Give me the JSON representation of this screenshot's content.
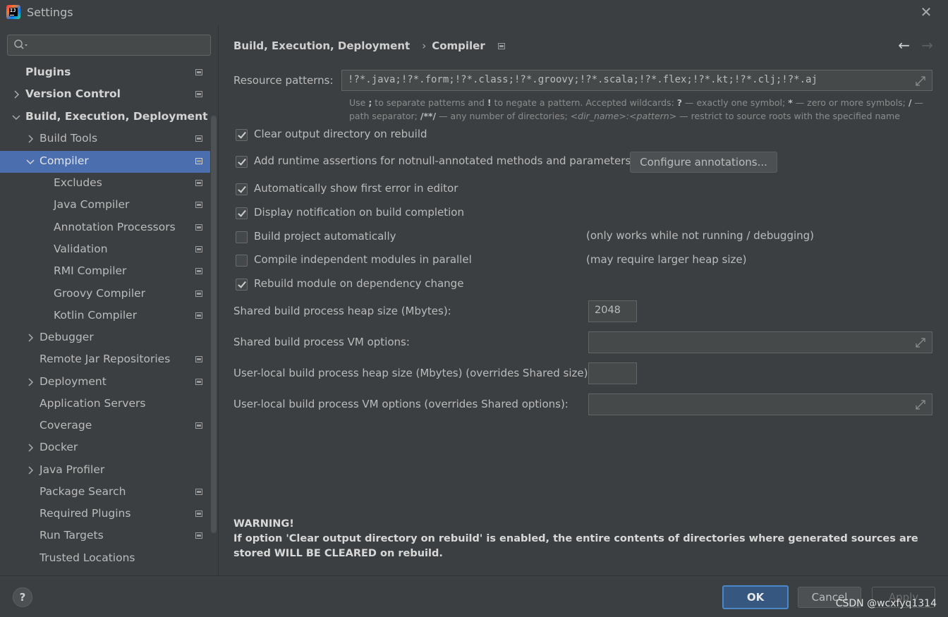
{
  "window": {
    "title": "Settings"
  },
  "search": {
    "placeholder": ""
  },
  "sidebar": {
    "items": [
      {
        "label": "Plugins"
      },
      {
        "label": "Version Control"
      },
      {
        "label": "Build, Execution, Deployment"
      },
      {
        "label": "Build Tools"
      },
      {
        "label": "Compiler"
      },
      {
        "label": "Excludes"
      },
      {
        "label": "Java Compiler"
      },
      {
        "label": "Annotation Processors"
      },
      {
        "label": "Validation"
      },
      {
        "label": "RMI Compiler"
      },
      {
        "label": "Groovy Compiler"
      },
      {
        "label": "Kotlin Compiler"
      },
      {
        "label": "Debugger"
      },
      {
        "label": "Remote Jar Repositories"
      },
      {
        "label": "Deployment"
      },
      {
        "label": "Application Servers"
      },
      {
        "label": "Coverage"
      },
      {
        "label": "Docker"
      },
      {
        "label": "Java Profiler"
      },
      {
        "label": "Package Search"
      },
      {
        "label": "Required Plugins"
      },
      {
        "label": "Run Targets"
      },
      {
        "label": "Trusted Locations"
      }
    ]
  },
  "breadcrumb": {
    "parent": "Build, Execution, Deployment",
    "current": "Compiler"
  },
  "resource_patterns": {
    "label": "Resource patterns:",
    "value": "!?*.java;!?*.form;!?*.class;!?*.groovy;!?*.scala;!?*.flex;!?*.kt;!?*.clj;!?*.aj"
  },
  "hint": {
    "l1a": "Use ",
    "l1b": ";",
    "l1c": " to separate patterns and ",
    "l1d": "!",
    "l1e": " to negate a pattern. Accepted wildcards: ",
    "l1f": "?",
    "l1g": " — exactly one symbol; ",
    "l1h": "*",
    "l1i": " — zero or more symbols; ",
    "l1j": "/",
    "l1k": " —",
    "l2a": "path separator; ",
    "l2b": "/**/",
    "l2c": " — any number of directories; ",
    "l2d": "<dir_name>:<pattern>",
    "l2e": " — restrict to source roots with the specified name"
  },
  "options": {
    "clear_output": {
      "label": "Clear output directory on rebuild",
      "checked": true
    },
    "runtime_assertions": {
      "label": "Add runtime assertions for notnull-annotated methods and parameters",
      "checked": true
    },
    "configure_annotations": "Configure annotations...",
    "show_first_error": {
      "label": "Automatically show first error in editor",
      "checked": true
    },
    "display_notification": {
      "label": "Display notification on build completion",
      "checked": true
    },
    "build_automatically": {
      "label": "Build project automatically",
      "checked": false,
      "note": "(only works while not running / debugging)"
    },
    "compile_parallel": {
      "label": "Compile independent modules in parallel",
      "checked": false,
      "note": "(may require larger heap size)"
    },
    "rebuild_on_change": {
      "label": "Rebuild module on dependency change",
      "checked": true
    }
  },
  "fields": {
    "shared_heap": {
      "label": "Shared build process heap size (Mbytes):",
      "value": "2048"
    },
    "shared_vm": {
      "label": "Shared build process VM options:",
      "value": ""
    },
    "user_heap": {
      "label": "User-local build process heap size (Mbytes) (overrides Shared size):",
      "value": ""
    },
    "user_vm": {
      "label": "User-local build process VM options (overrides Shared options):",
      "value": ""
    }
  },
  "warning": {
    "title": "WARNING!",
    "text": "If option 'Clear output directory on rebuild' is enabled, the entire contents of directories where generated sources are stored WILL BE CLEARED on rebuild."
  },
  "footer": {
    "help": "?",
    "ok": "OK",
    "cancel": "Cancel",
    "apply": "Apply"
  },
  "watermark": "CSDN @wcxfyq1314",
  "colors": {
    "background": "#3c3f41",
    "selection": "#4b6eaf",
    "ok_button": "#365880",
    "text": "#bbbbbb"
  }
}
